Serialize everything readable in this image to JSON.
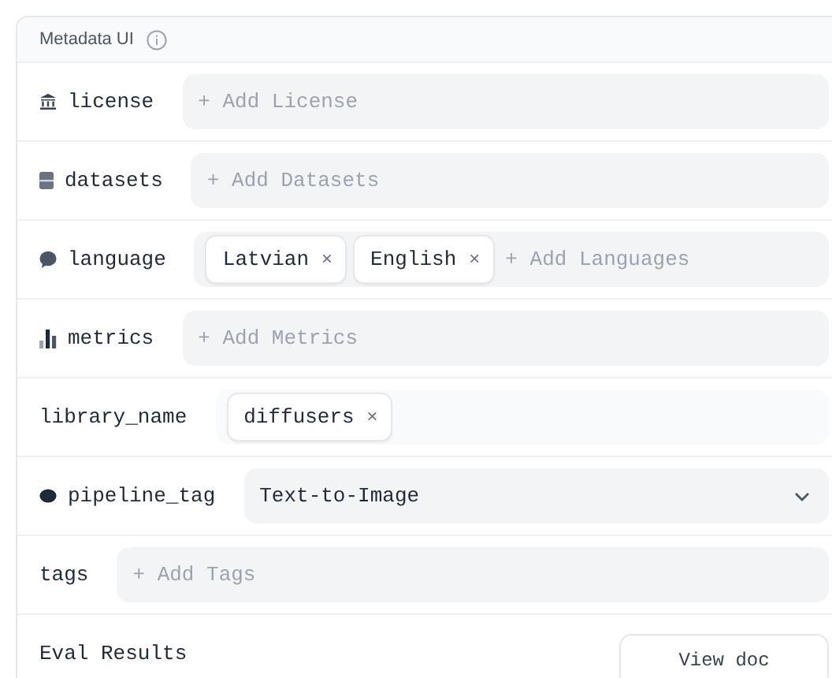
{
  "header": {
    "title": "Metadata UI"
  },
  "rows": [
    {
      "label": "license",
      "field": {
        "kind": "tags",
        "placeholder": "+ Add License"
      }
    },
    {
      "label": "datasets",
      "field": {
        "kind": "tags",
        "placeholder": "+ Add Datasets"
      }
    },
    {
      "label": "language",
      "field": {
        "kind": "tags",
        "chips": [
          {
            "text": "Latvian",
            "remove": "×"
          },
          {
            "text": "English",
            "remove": "×"
          }
        ],
        "placeholder": "+ Add Languages"
      }
    },
    {
      "label": "metrics",
      "field": {
        "kind": "tags",
        "placeholder": "+ Add Metrics"
      }
    },
    {
      "label": "library_name",
      "field": {
        "kind": "tags",
        "chips": [
          {
            "text": "diffusers",
            "remove": "×"
          }
        ]
      }
    },
    {
      "label": "pipeline_tag",
      "field": {
        "kind": "select",
        "value": "Text-to-Image"
      }
    },
    {
      "label": "tags",
      "field": {
        "kind": "tags",
        "placeholder": "+ Add Tags"
      }
    },
    {
      "label": "Eval Results",
      "field": {
        "kind": "button",
        "text": "View doc"
      }
    }
  ]
}
